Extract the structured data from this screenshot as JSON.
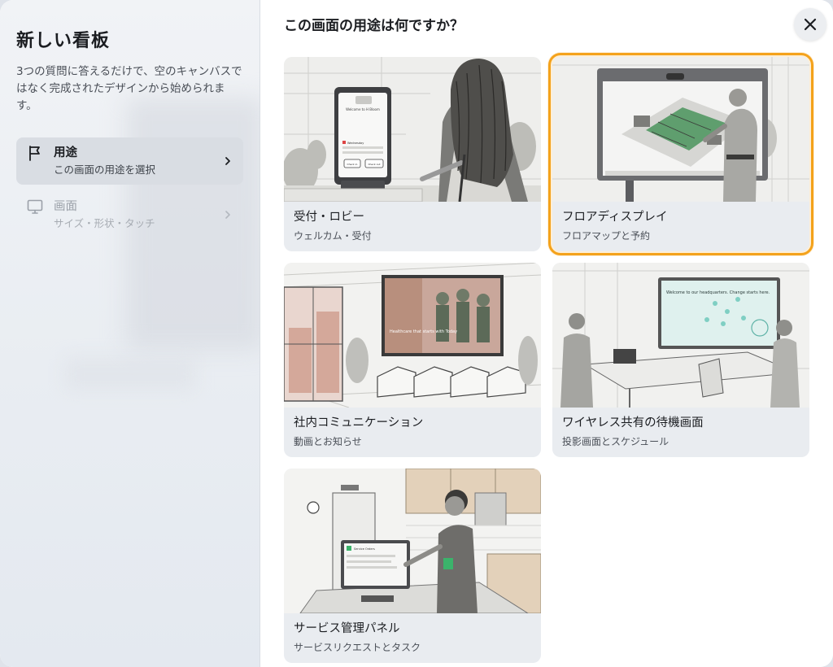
{
  "sidebar": {
    "title": "新しい看板",
    "description": "3つの質問に答えるだけで、空のキャンバスではなく完成されたデザインから始められます。",
    "steps": [
      {
        "label": "用途",
        "sublabel": "この画面の用途を選択",
        "icon": "flag-icon",
        "active": true
      },
      {
        "label": "画面",
        "sublabel": "サイズ・形状・タッチ",
        "icon": "monitor-icon",
        "active": false
      }
    ]
  },
  "main": {
    "title": "この画面の用途は何ですか？",
    "close_icon": "close-icon",
    "cards": [
      {
        "title": "受付・ロビー",
        "subtitle": "ウェルカム・受付",
        "selected": false
      },
      {
        "title": "フロアディスプレイ",
        "subtitle": "フロアマップと予約",
        "selected": true
      },
      {
        "title": "社内コミュニケーション",
        "subtitle": "動画とお知らせ",
        "selected": false
      },
      {
        "title": "ワイヤレス共有の待機画面",
        "subtitle": "投影画面とスケジュール",
        "selected": false
      },
      {
        "title": "サービス管理パネル",
        "subtitle": "サービスリクエストとタスク",
        "selected": false
      }
    ],
    "illustration_text": {
      "kiosk_welcome": "Welcome to H Bloom",
      "kiosk_day": "Wednesday",
      "kiosk_checkin": "Check in",
      "kiosk_checkout": "Check out",
      "poster_text": "Healthcare that starts with Today",
      "tv_text": "Welcome to our headquarters. Change starts here.",
      "tablet_header": "Service Orders"
    }
  },
  "colors": {
    "selected_outline": "#f4a21b",
    "card_background": "#e9ecf0",
    "active_step_background": "#d9dde3"
  }
}
